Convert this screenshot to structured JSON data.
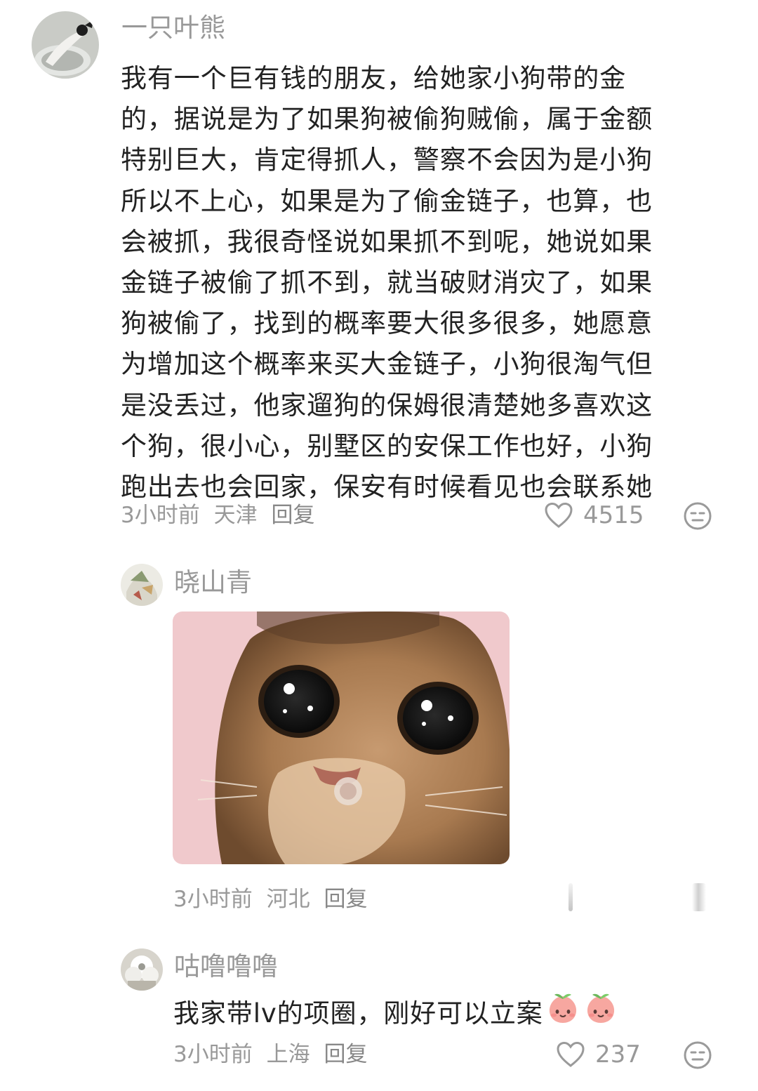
{
  "comments": [
    {
      "username": "一只叶熊",
      "text_lines": [
        "我有一个巨有钱的朋友，给她家小狗带的金",
        "的，据说是为了如果狗被偷狗贼偷，属于金额",
        "特别巨大，肯定得抓人，警察不会因为是小狗",
        "所以不上心，如果是为了偷金链子，也算，也",
        "会被抓，我很奇怪说如果抓不到呢，她说如果",
        "金链子被偷了抓不到，就当破财消灾了，如果",
        "狗被偷了，找到的概率要大很多很多，她愿意",
        "为增加这个概率来买大金链子，小狗很淘气但",
        "是没丢过，他家遛狗的保姆很清楚她多喜欢这",
        "个狗，很小心，别墅区的安保工作也好，小狗",
        "跑出去也会回家，保安有时候看见也会联系她"
      ],
      "time": "3小时前",
      "location": "天津",
      "reply_label": "回复",
      "like_count": "4515",
      "like_icon": "heart-outline-icon",
      "dislike_icon": "meh-face-icon"
    },
    {
      "username": "晓山青",
      "image": "crying-cat-meme",
      "time": "3小时前",
      "location": "河北",
      "reply_label": "回复"
    },
    {
      "username": "咕噜噜噜",
      "text": "我家带lv的项圈，刚好可以立案",
      "emoji": "peach-face-emoji",
      "time": "3小时前",
      "location": "上海",
      "reply_label": "回复",
      "like_count": "237",
      "like_icon": "heart-outline-icon",
      "dislike_icon": "meh-face-icon"
    }
  ],
  "colors": {
    "text": "#222222",
    "meta": "#999999",
    "background": "#ffffff",
    "icon": "#9a9a9a"
  }
}
